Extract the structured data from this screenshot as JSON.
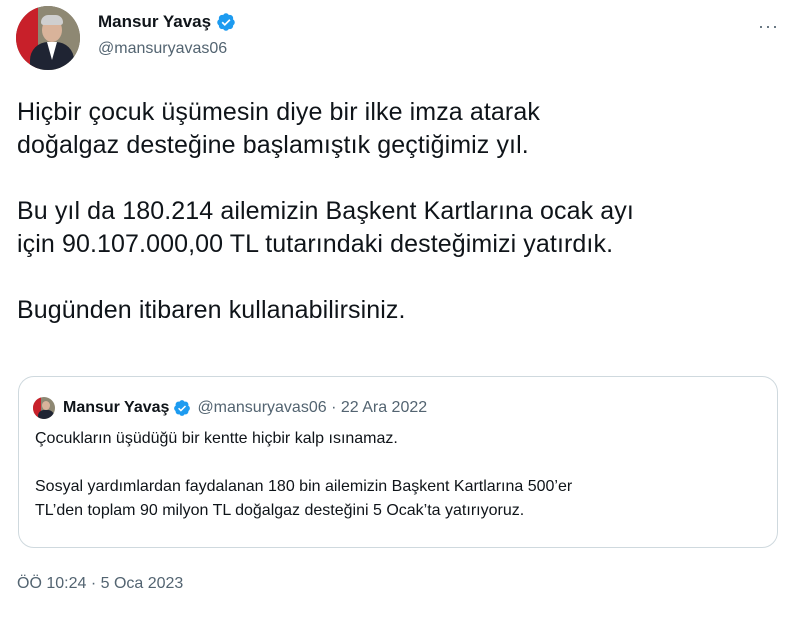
{
  "author": {
    "name": "Mansur Yavaş",
    "handle": "@mansuryavas06"
  },
  "menu": {
    "more_label": "···"
  },
  "tweet": {
    "paragraphs": [
      "Hiçbir çocuk üşümesin diye bir ilke imza atarak\ndoğalgaz desteğine başlamıştık geçtiğimiz yıl.",
      "Bu yıl da 180.214 ailemizin Başkent Kartlarına ocak ayı\niçin 90.107.000,00 TL tutarındaki desteğimizi yatırdık.",
      "Bugünden itibaren kullanabilirsiniz."
    ],
    "timestamp": "ÖÖ 10:24 · 5 Oca 2023"
  },
  "quoted_tweet": {
    "name": "Mansur Yavaş",
    "meta": "@mansuryavas06 · 22 Ara 2022",
    "paragraphs": [
      "Çocukların üşüdüğü bir kentte hiçbir kalp ısınamaz.",
      "Sosyal yardımlardan faydalanan 180 bin ailemizin Başkent Kartlarına 500’er\nTL’den toplam 90 milyon TL doğalgaz desteğini 5 Ocak’ta yatırıyoruz."
    ]
  },
  "colors": {
    "verified": "#1d9bf0",
    "secondary_text": "#536471",
    "border": "#cfd9de"
  }
}
